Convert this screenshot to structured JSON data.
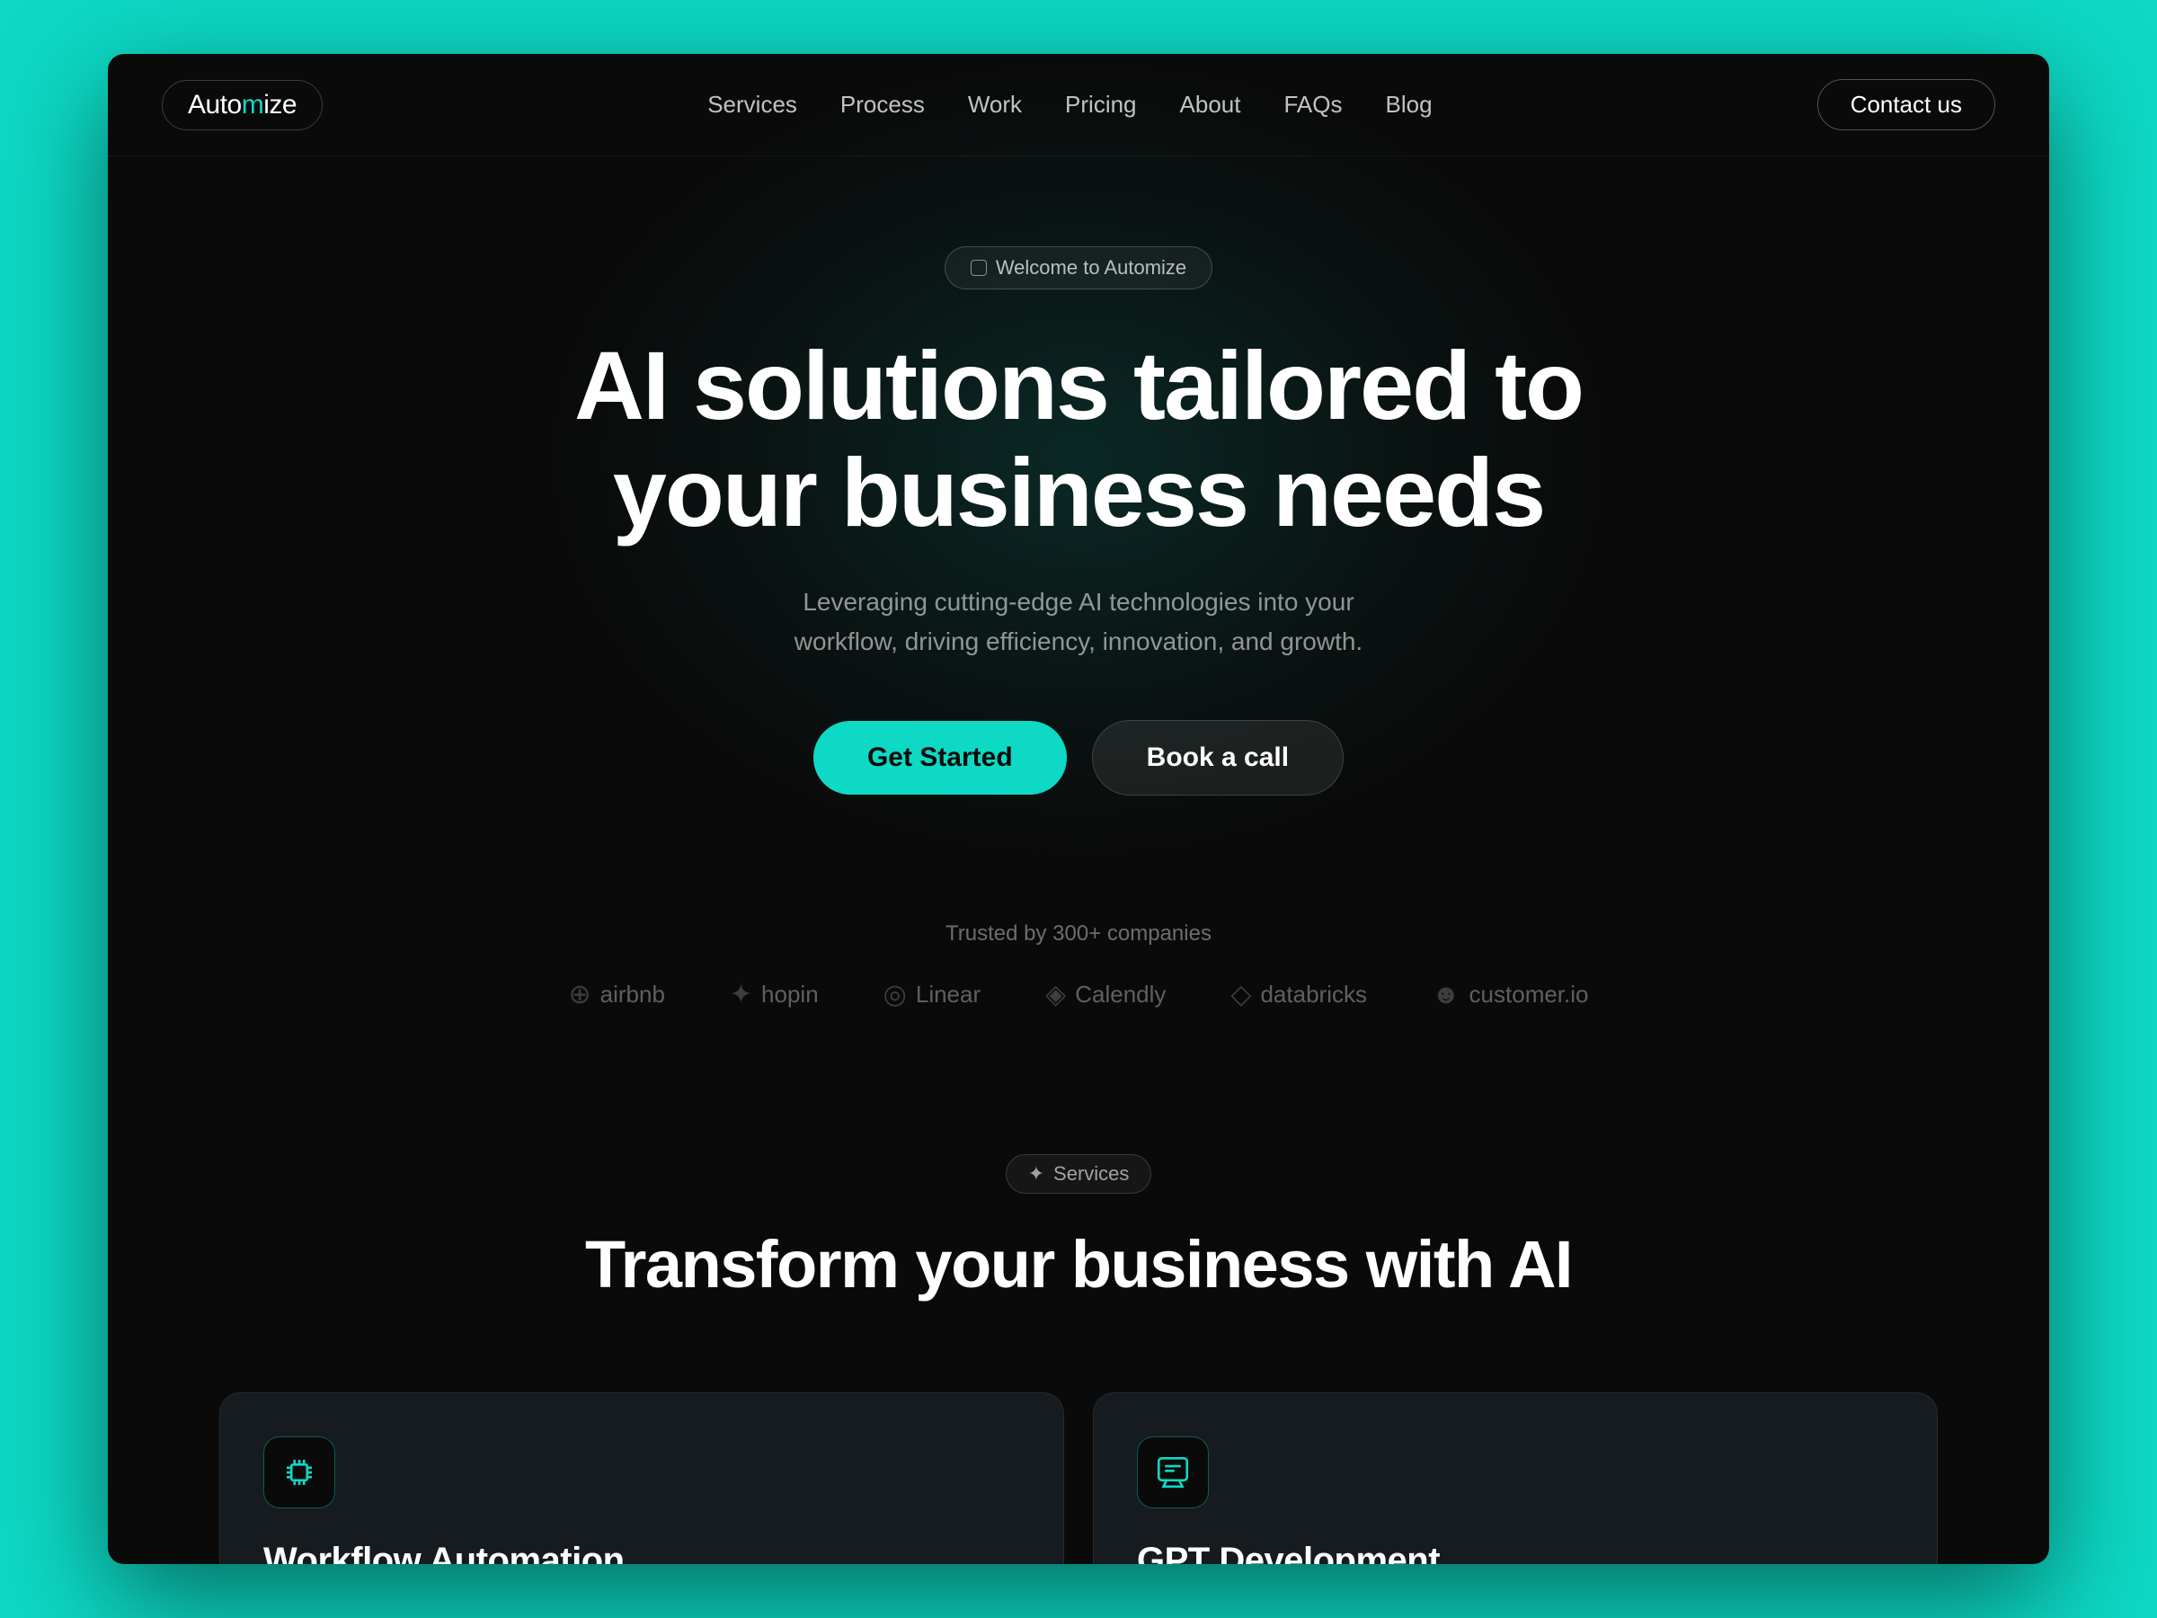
{
  "page": {
    "background": "#0a0a0a"
  },
  "navbar": {
    "logo_prefix": "Auto",
    "logo_accent": "m",
    "logo_suffix": "ize",
    "links": [
      {
        "label": "Services",
        "id": "services"
      },
      {
        "label": "Process",
        "id": "process"
      },
      {
        "label": "Work",
        "id": "work"
      },
      {
        "label": "Pricing",
        "id": "pricing"
      },
      {
        "label": "About",
        "id": "about"
      },
      {
        "label": "FAQs",
        "id": "faqs"
      },
      {
        "label": "Blog",
        "id": "blog"
      }
    ],
    "contact_btn": "Contact us"
  },
  "hero": {
    "badge_text": "Welcome to Automize",
    "title_line1": "AI solutions tailored to",
    "title_line2": "your business needs",
    "subtitle": "Leveraging cutting-edge AI technologies into your workflow, driving efficiency, innovation, and growth.",
    "btn_primary": "Get Started",
    "btn_secondary": "Book a call"
  },
  "trusted": {
    "label": "Trusted by 300+ companies",
    "companies": [
      {
        "name": "airbnb",
        "icon": "⊕"
      },
      {
        "name": "hopin",
        "icon": "✦"
      },
      {
        "name": "Linear",
        "icon": "◎"
      },
      {
        "name": "Calendly",
        "icon": "◈"
      },
      {
        "name": "databricks",
        "icon": "◇"
      },
      {
        "name": "customer.io",
        "icon": "☻"
      }
    ]
  },
  "services": {
    "badge_text": "Services",
    "title": "Transform your business with AI",
    "cards": [
      {
        "id": "workflow-automation",
        "title": "Workflow Automation",
        "icon_type": "chip"
      },
      {
        "id": "gpt-development",
        "title": "GPT Development",
        "icon_type": "chat"
      }
    ]
  }
}
